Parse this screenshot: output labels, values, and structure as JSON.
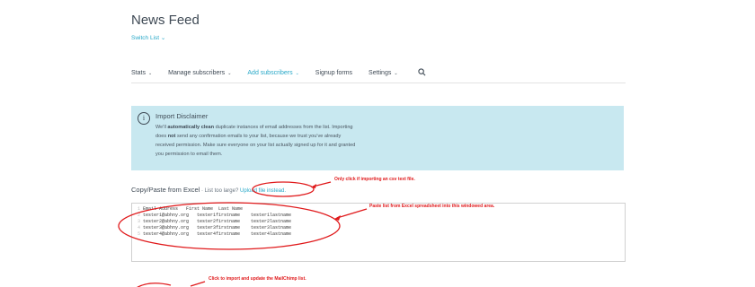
{
  "page": {
    "title": "News Feed",
    "switch_list": "Switch List ⌄"
  },
  "nav": {
    "items": [
      {
        "label": "Stats",
        "chevron": "⌄"
      },
      {
        "label": "Manage subscribers",
        "chevron": "⌄"
      },
      {
        "label": "Add subscribers",
        "chevron": "⌄",
        "active": true
      },
      {
        "label": "Signup forms",
        "chevron": ""
      },
      {
        "label": "Settings",
        "chevron": "⌄"
      }
    ],
    "search_icon": "search-icon"
  },
  "disclaimer": {
    "title": "Import Disclaimer",
    "icon": "info-icon",
    "body_line1_pre": "We'll ",
    "body_line1_bold": "automatically clean",
    "body_line1_post": " duplicate instances of email addresses from the list. Importing",
    "body_line2_pre": "does ",
    "body_line2_bold": "not",
    "body_line2_post": " send any confirmation emails to your list, because we trust you've already",
    "body_line3": "received permission. Make sure everyone on your list actually signed up for it and granted",
    "body_line4": "you permission to email them."
  },
  "copy_paste": {
    "title": "Copy/Paste from Excel",
    "subtitle": " · List too large? ",
    "link": "Upload file instead."
  },
  "paste_rows": [
    {
      "num": "1",
      "text": "Email Address   First Name  Last Name"
    },
    {
      "num": "2",
      "text": "tester1@abhny.org   tester1firstname    tester1lastname"
    },
    {
      "num": "3",
      "text": "tester2@abhny.org   tester2firstname    tester2lastname"
    },
    {
      "num": "4",
      "text": "tester3@abhny.org   tester3firstname    tester3lastname"
    },
    {
      "num": "5",
      "text": "tester4@abhny.org   tester4firstname    tester4lastname"
    }
  ],
  "annotations": {
    "csv": "Only click if importing an csv text file.",
    "paste": "Paste list from Excel spreadsheet into this windowed area.",
    "import": "Click to import and update the MailChimp list."
  },
  "colors": {
    "accent": "#28a8c8",
    "annotation": "#e0191b",
    "disclaimer_bg": "#c8e8f0"
  }
}
